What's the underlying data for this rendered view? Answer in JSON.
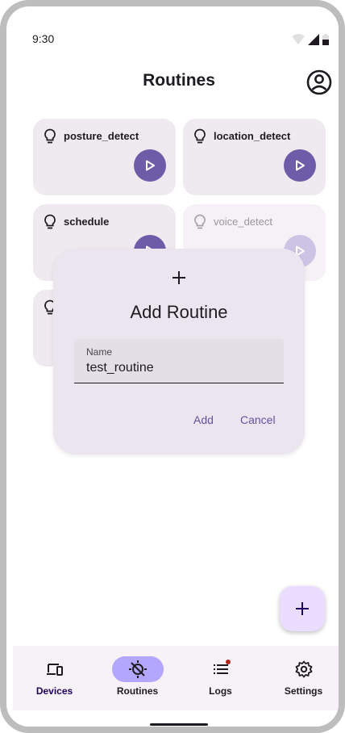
{
  "status": {
    "time": "9:30"
  },
  "appbar": {
    "title": "Routines"
  },
  "routines": [
    {
      "name": "posture_detect"
    },
    {
      "name": "location_detect"
    },
    {
      "name": "schedule"
    },
    {
      "name": "voice_detect"
    }
  ],
  "dialog": {
    "title": "Add Routine",
    "field_label": "Name",
    "field_value": "test_routine",
    "add_label": "Add",
    "cancel_label": "Cancel"
  },
  "nav": {
    "items": [
      {
        "label": "Devices"
      },
      {
        "label": "Routines"
      },
      {
        "label": "Logs"
      },
      {
        "label": "Settings"
      }
    ],
    "active": "Routines"
  },
  "colors": {
    "accent": "#6f5ca8",
    "card": "#efeaef",
    "dialog": "#ebe5f0",
    "fab": "#eaddff",
    "nav_active": "#b3a6ff",
    "badge": "#b3261e"
  },
  "icons": {
    "routine": "lightbulb-icon",
    "play": "play-icon",
    "account": "account-circle-icon",
    "dialog": "plus-icon",
    "fab": "plus-icon",
    "nav": [
      "devices-icon",
      "routines-icon",
      "logs-icon",
      "settings-icon"
    ]
  }
}
